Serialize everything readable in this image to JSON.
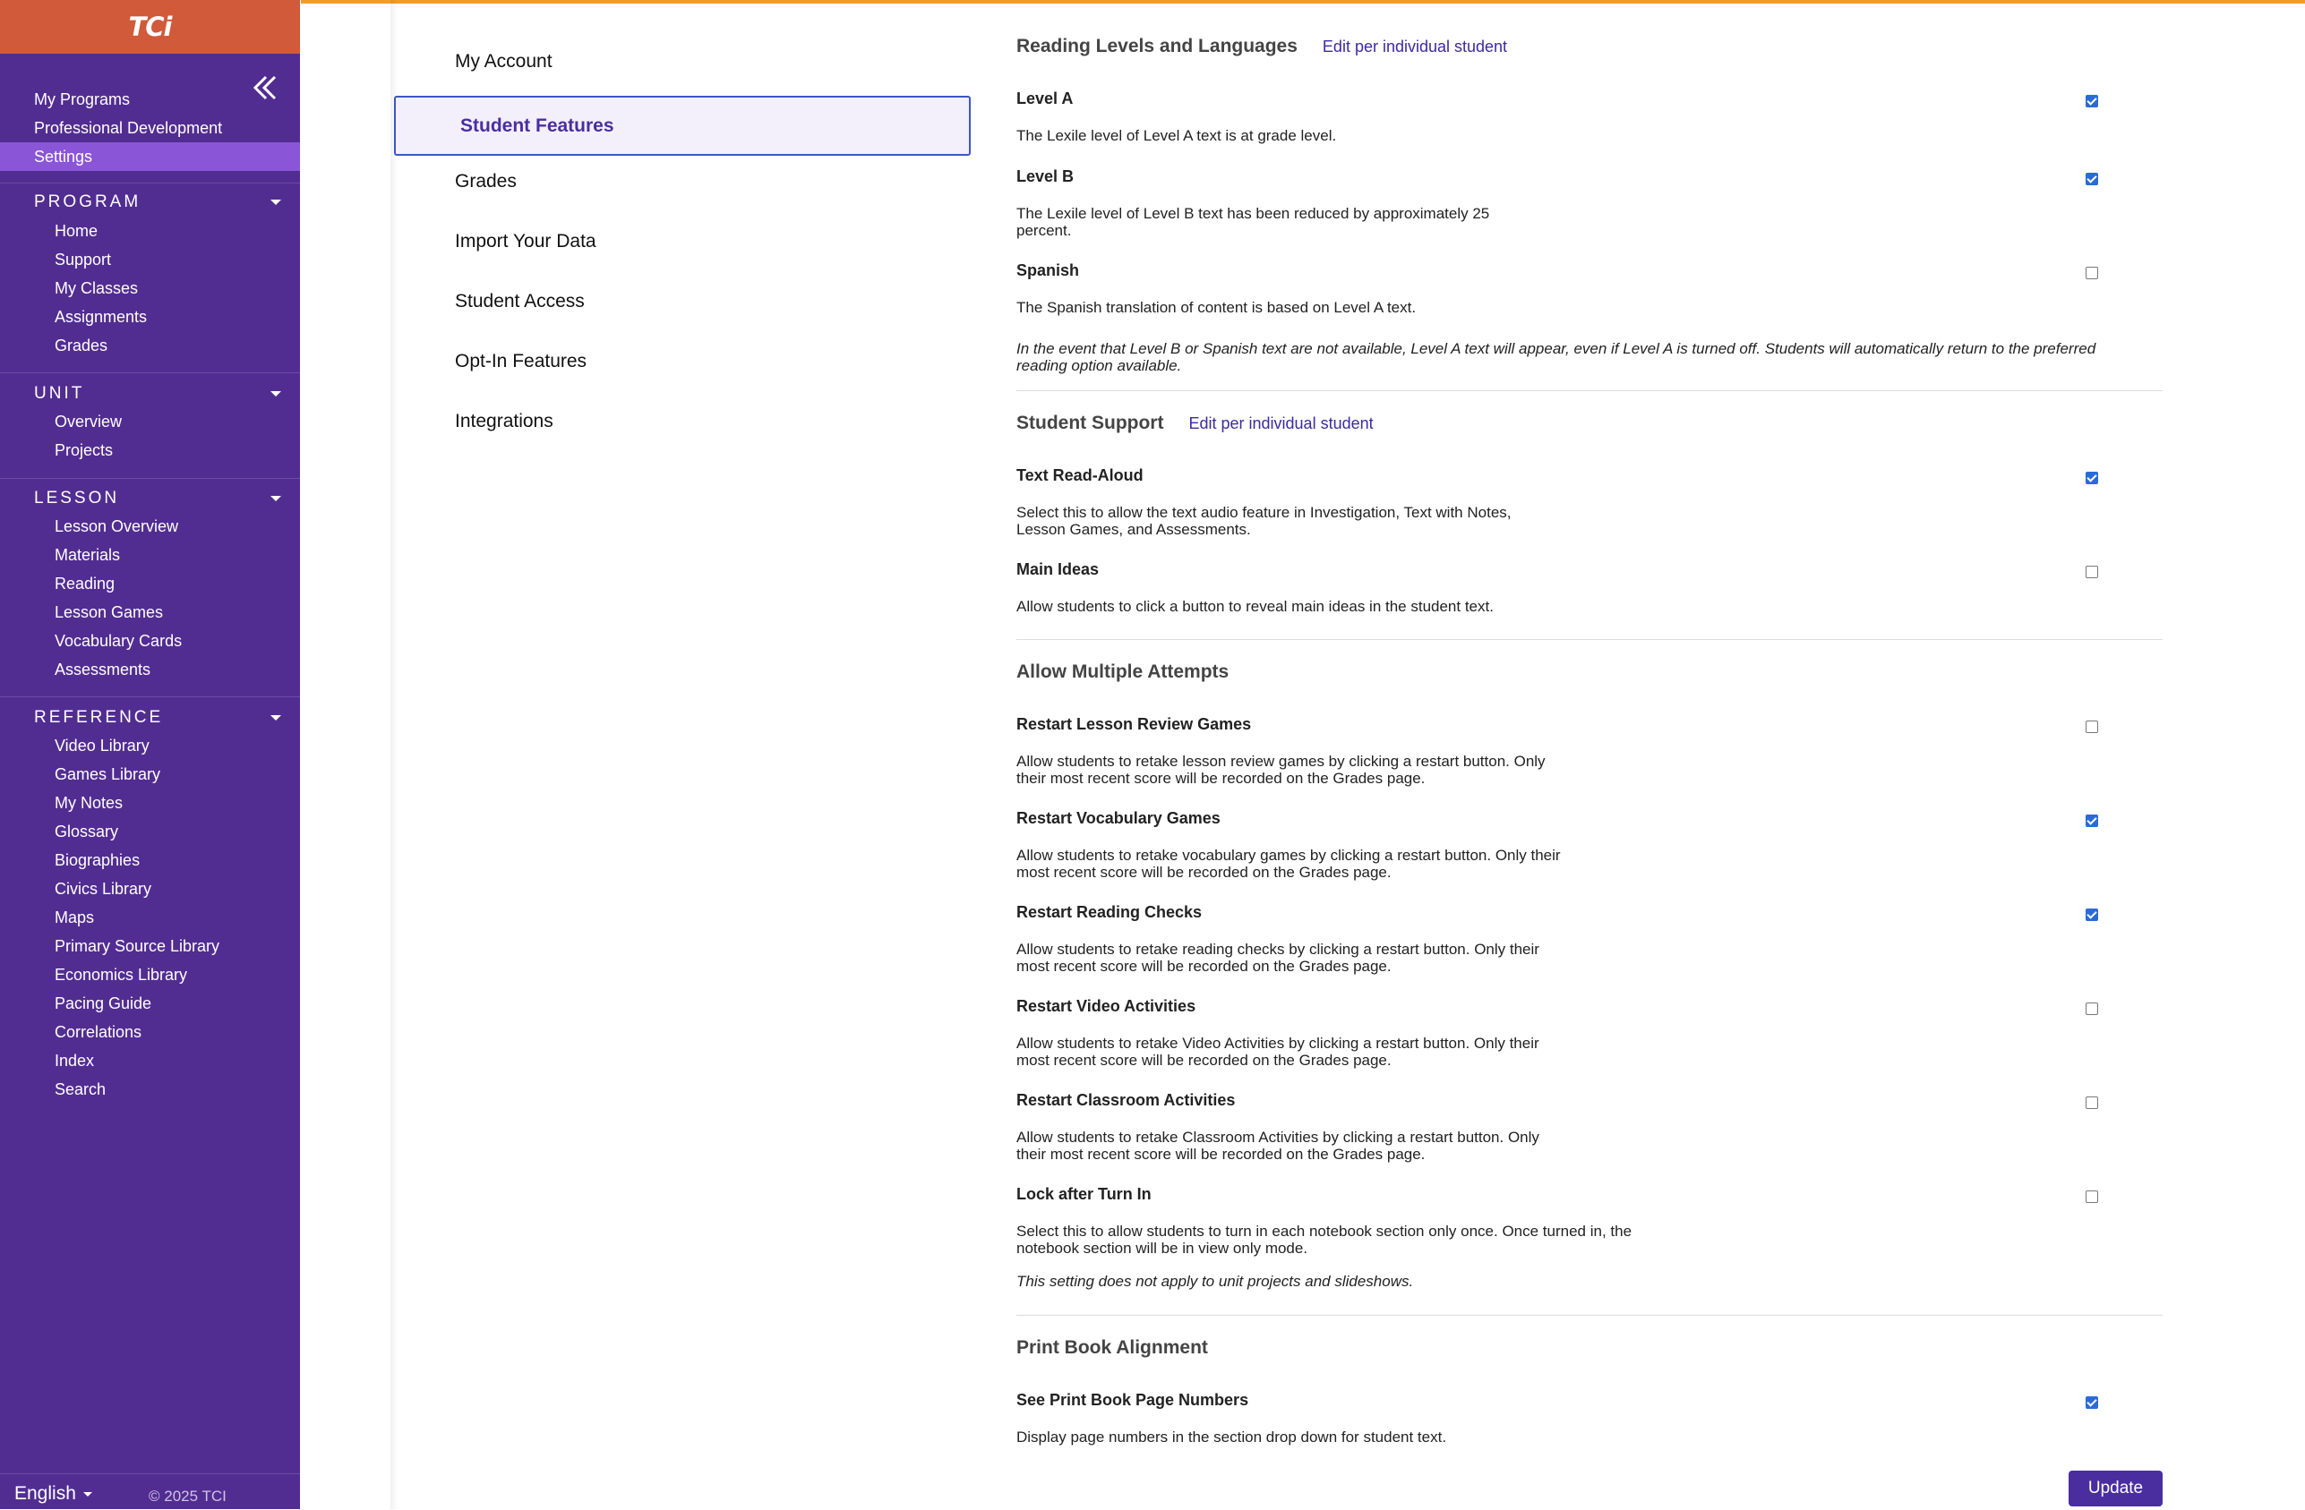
{
  "brand": {
    "logo": "TCi"
  },
  "sidebar": {
    "top_links": [
      {
        "label": "My Programs",
        "active": false
      },
      {
        "label": "Professional Development",
        "active": false
      },
      {
        "label": "Settings",
        "active": true
      }
    ],
    "sections": [
      {
        "title": "PROGRAM",
        "items": [
          "Home",
          "Support",
          "My Classes",
          "Assignments",
          "Grades"
        ]
      },
      {
        "title": "UNIT",
        "items": [
          "Overview",
          "Projects"
        ]
      },
      {
        "title": "LESSON",
        "items": [
          "Lesson Overview",
          "Materials",
          "Reading",
          "Lesson Games",
          "Vocabulary Cards",
          "Assessments"
        ]
      },
      {
        "title": "REFERENCE",
        "items": [
          "Video Library",
          "Games Library",
          "My Notes",
          "Glossary",
          "Biographies",
          "Civics Library",
          "Maps",
          "Primary Source Library",
          "Economics Library",
          "Pacing Guide",
          "Correlations",
          "Index",
          "Search"
        ]
      }
    ],
    "footer": {
      "language": "English",
      "copyright": "© 2025 TCI"
    }
  },
  "settings_menu": {
    "items": [
      "My Account",
      "Student Features",
      "Grades",
      "Import Your Data",
      "Student Access",
      "Opt-In Features",
      "Integrations"
    ],
    "active": "Student Features"
  },
  "main": {
    "reading_levels": {
      "title": "Reading Levels and Languages",
      "link": "Edit per individual student",
      "options": [
        {
          "title": "Level A",
          "desc": "The Lexile level of Level A text is at grade level.",
          "checked": true
        },
        {
          "title": "Level B",
          "desc": "The Lexile level of Level B text has been reduced by approximately 25 percent.",
          "checked": true
        },
        {
          "title": "Spanish",
          "desc": "The Spanish translation of content is based on Level A text.",
          "checked": false
        }
      ],
      "note": "In the event that Level B or Spanish text are not available, Level A text will appear, even if Level A is turned off. Students will automatically return to the preferred reading option available."
    },
    "student_support": {
      "title": "Student Support",
      "link": "Edit per individual student",
      "options": [
        {
          "title": "Text Read-Aloud",
          "desc": "Select this to allow the text audio feature in Investigation, Text with Notes, Lesson Games, and Assessments.",
          "checked": true
        },
        {
          "title": "Main Ideas",
          "desc": "Allow students to click a button to reveal main ideas in the student text.",
          "checked": false
        }
      ]
    },
    "multiple_attempts": {
      "title": "Allow Multiple Attempts",
      "options": [
        {
          "title": "Restart Lesson Review Games",
          "desc": "Allow students to retake lesson review games by clicking a restart button. Only their most recent score will be recorded on the Grades page.",
          "checked": false
        },
        {
          "title": "Restart Vocabulary Games",
          "desc": "Allow students to retake vocabulary games by clicking a restart button. Only their most recent score will be recorded on the Grades page.",
          "checked": true
        },
        {
          "title": "Restart Reading Checks",
          "desc": "Allow students to retake reading checks by clicking a restart button. Only their most recent score will be recorded on the Grades page.",
          "checked": true
        },
        {
          "title": "Restart Video Activities",
          "desc": "Allow students to retake Video Activities by clicking a restart button. Only their most recent score will be recorded on the Grades page.",
          "checked": false
        },
        {
          "title": "Restart Classroom Activities",
          "desc": "Allow students to retake Classroom Activities by clicking a restart button. Only their most recent score will be recorded on the Grades page.",
          "checked": false
        },
        {
          "title": "Lock after Turn In",
          "desc": "Select this to allow students to turn in each notebook section only once. Once turned in, the notebook section will be in view only mode.",
          "checked": false
        }
      ],
      "note": "This setting does not apply to unit projects and slideshows."
    },
    "print_book": {
      "title": "Print Book Alignment",
      "options": [
        {
          "title": "See Print Book Page Numbers",
          "desc": "Display page numbers in the section drop down for student text.",
          "checked": true
        }
      ]
    },
    "update_label": "Update"
  },
  "colors": {
    "sidebar": "#522d91",
    "logo_bar": "#d05a3a",
    "active_nav": "#8a55d6",
    "accent": "#4a2ea0",
    "checkbox": "#2a6bd8",
    "top_line": "#f29a2e"
  }
}
